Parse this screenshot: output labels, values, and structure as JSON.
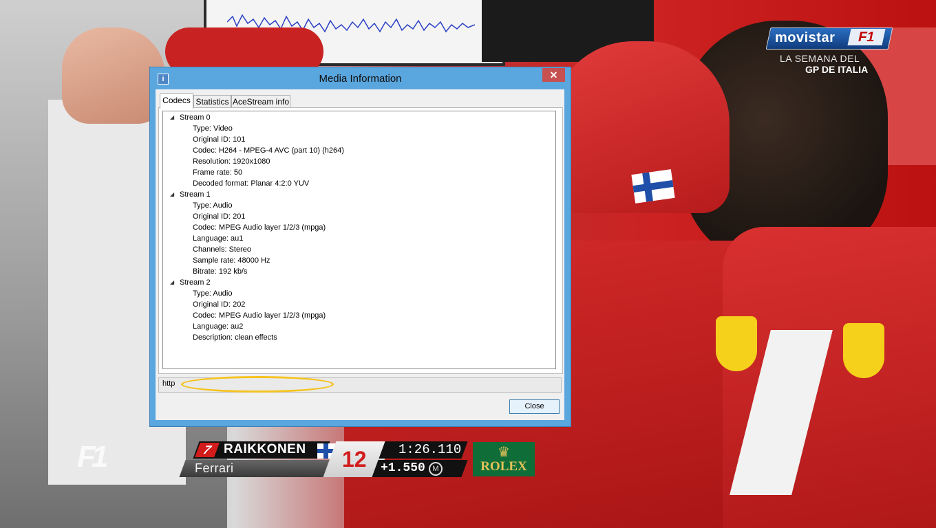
{
  "broadcast": {
    "channel_brand": "movistar",
    "channel_f1": "F1",
    "show_title_line1": "LA SEMANA DEL",
    "show_title_line2": "GP DE ITALIA",
    "f1_logo": "F1",
    "timing": {
      "car_number": "7",
      "driver": "RAIKKONEN",
      "team": "Ferrari",
      "position": "12",
      "lap_time": "1:26.110",
      "gap": "+1.550",
      "medium_tyre": "M"
    },
    "sponsor": {
      "crown": "♛",
      "name": "ROLEX"
    }
  },
  "dialog": {
    "title": "Media Information",
    "close_glyph": "✕",
    "info_glyph": "i",
    "tabs": [
      {
        "label": "Codecs",
        "active": true
      },
      {
        "label": "Statistics",
        "active": false
      },
      {
        "label": "AceStream info",
        "active": false
      }
    ],
    "streams": [
      {
        "label": "Stream 0",
        "props": [
          "Type: Video",
          "Original ID: 101",
          "Codec: H264 - MPEG-4 AVC (part 10) (h264)",
          "Resolution: 1920x1080",
          "Frame rate: 50",
          "Decoded format: Planar 4:2:0 YUV"
        ]
      },
      {
        "label": "Stream 1",
        "props": [
          "Type: Audio",
          "Original ID: 201",
          "Codec: MPEG Audio layer 1/2/3 (mpga)",
          "Language: au1",
          "Channels: Stereo",
          "Sample rate: 48000 Hz",
          "Bitrate: 192 kb/s"
        ]
      },
      {
        "label": "Stream 2",
        "props": [
          "Type: Audio",
          "Original ID: 202",
          "Codec: MPEG Audio layer 1/2/3 (mpga)",
          "Language: au2",
          "Description: clean effects"
        ]
      }
    ],
    "location": "http",
    "close_button": "Close"
  },
  "colors": {
    "titlebar": "#5aa6de",
    "close_x": "#c75050",
    "highlight_ring": "#f5c320",
    "ferrari_red": "#c92222"
  }
}
